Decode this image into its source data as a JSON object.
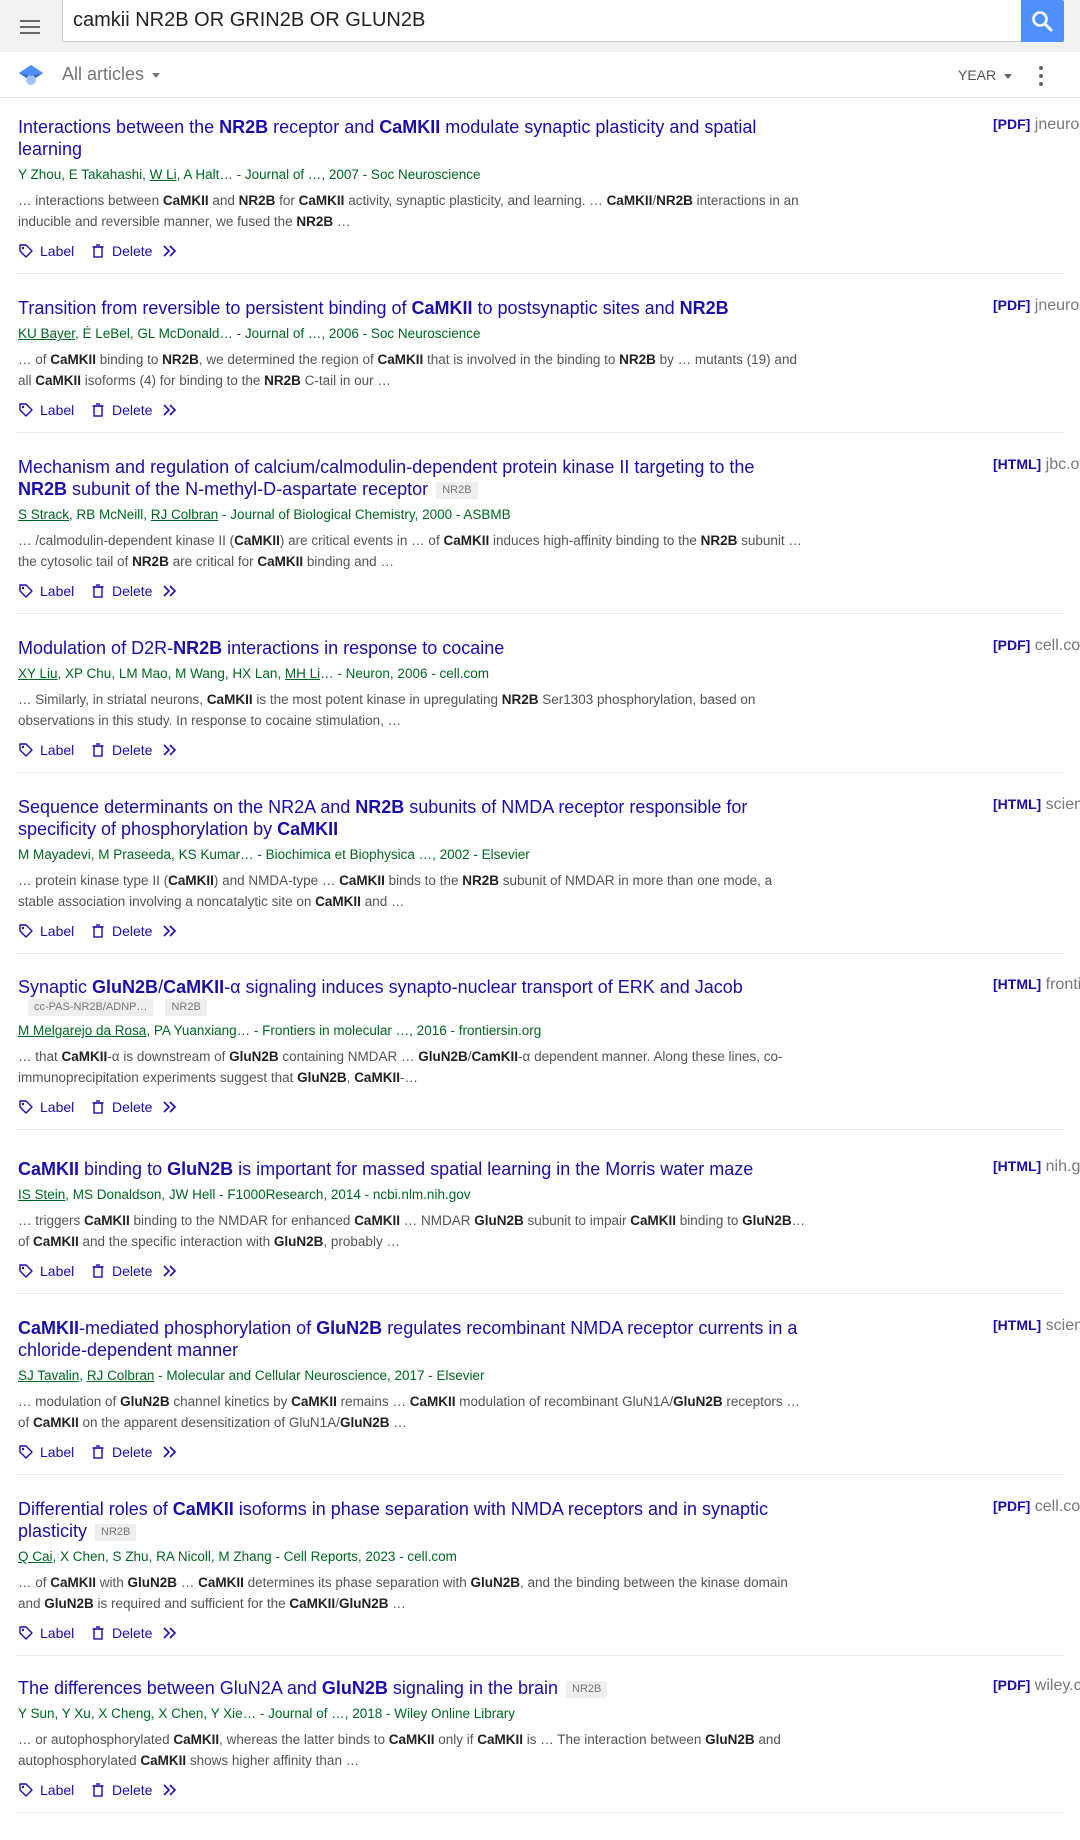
{
  "search": {
    "query": "camkii NR2B OR GRIN2B OR GLUN2B"
  },
  "filter": {
    "all_articles": "All articles",
    "year": "YEAR"
  },
  "actions": {
    "label": "Label",
    "delete": "Delete"
  },
  "results": [
    {
      "title_html": "Interactions between the <b>NR2B</b> receptor and <b>CaMKII</b> modulate synaptic plasticity and spatial learning",
      "authors_html": "Y Zhou, E Takahashi, <u>W Li</u>, A Halt… - Journal of …, 2007 - Soc Neuroscience",
      "snippet_html": "… interactions between <b>CaMKII</b> and <b>NR2B</b> for <b>CaMKII</b> activity, synaptic plasticity, and learning. … <b>CaMKII</b>/<b>NR2B</b> interactions in an inducible and reversible manner, we fused the <b>NR2B</b> …",
      "file_tag": "[PDF]",
      "file_domain": "jneurosci.org"
    },
    {
      "title_html": "Transition from reversible to persistent binding of <b>CaMKII</b> to postsynaptic sites and <b>NR2B</b>",
      "authors_html": "<u>KU Bayer</u>, É LeBel, GL McDonald… - Journal of …, 2006 - Soc Neuroscience",
      "snippet_html": "… of <b>CaMKII</b> binding to <b>NR2B</b>, we determined the region of <b>CaMKII</b> that is involved in the binding to <b>NR2B</b> by … mutants (19) and all <b>CaMKII</b> isoforms (4) for binding to the <b>NR2B</b> C-tail in our …",
      "file_tag": "[PDF]",
      "file_domain": "jneurosci.org"
    },
    {
      "title_html": "Mechanism and regulation of calcium/calmodulin-dependent protein kinase II targeting to the <b>NR2B</b> subunit of the N-methyl-D-aspartate receptor",
      "badges": [
        "NR2B"
      ],
      "authors_html": "<u>S Strack</u>, RB McNeill, <u>RJ Colbran</u> - Journal of Biological Chemistry, 2000 - ASBMB",
      "snippet_html": "… /calmodulin-dependent kinase II (<b>CaMKII</b>) are critical events in … of <b>CaMKII</b> induces high-affinity binding to the <b>NR2B</b> subunit … the cytosolic tail of <b>NR2B</b> are critical for <b>CaMKII</b> binding and …",
      "file_tag": "[HTML]",
      "file_domain": "jbc.org"
    },
    {
      "title_html": "Modulation of D2R-<b>NR2B</b> interactions in response to cocaine",
      "authors_html": "<u>XY Liu</u>, XP Chu, LM Mao, M Wang, HX Lan, <u>MH Li</u>… - Neuron, 2006 - cell.com",
      "snippet_html": "… Similarly, in striatal neurons, <b>CaMKII</b> is the most potent kinase in upregulating <b>NR2B</b> Ser1303 phosphorylation, based on observations in this study. In response to cocaine stimulation, …",
      "file_tag": "[PDF]",
      "file_domain": "cell.com"
    },
    {
      "title_html": "Sequence determinants on the NR2A and <b>NR2B</b> subunits of NMDA receptor responsible for specificity of phosphorylation by <b>CaMKII</b>",
      "authors_html": "M Mayadevi, M Praseeda, KS Kumar… - Biochimica et Biophysica …, 2002 - Elsevier",
      "snippet_html": "… protein kinase type II (<b>CaMKII</b>) and NMDA-type … <b>CaMKII</b> binds to the <b>NR2B</b> subunit of NMDAR in more than one mode, a stable association involving a noncatalytic site on <b>CaMKII</b> and …",
      "file_tag": "[HTML]",
      "file_domain": "sciencedirect.com"
    },
    {
      "title_html": "Synaptic <b>GluN2B</b>/<b>CaMKII</b>-α signaling induces synapto-nuclear transport of ERK and Jacob",
      "badge_row": [
        "cc-PAS-NR2B/ADNP…",
        "NR2B"
      ],
      "authors_html": "<u>M Melgarejo da Rosa</u>, PA Yuanxiang… - Frontiers in molecular …, 2016 - frontiersin.org",
      "snippet_html": "… that <b>CaMKII</b>-α is downstream of <b>GluN2B</b> containing NMDAR … <b>GluN2B</b>/<b>CamKII</b>-α dependent manner. Along these lines, co-immunoprecipitation experiments suggest that <b>GluN2B</b>, <b>CaMKII</b>-…",
      "file_tag": "[HTML]",
      "file_domain": "frontiersin.org"
    },
    {
      "title_html": "<b>CaMKII</b> binding to <b>GluN2B</b> is important for massed spatial learning in the Morris water maze",
      "authors_html": "<u>IS Stein</u>, MS Donaldson, JW Hell - F1000Research, 2014 - ncbi.nlm.nih.gov",
      "snippet_html": "… triggers <b>CaMKII</b> binding to the NMDAR for enhanced <b>CaMKII</b> … NMDAR <b>GluN2B</b> subunit to impair <b>CaMKII</b> binding to <b>GluN2B</b>… of <b>CaMKII</b> and the specific interaction with <b>GluN2B</b>, probably …",
      "file_tag": "[HTML]",
      "file_domain": "nih.gov"
    },
    {
      "title_html": "<b>CaMKII</b>-mediated phosphorylation of <b>GluN2B</b> regulates recombinant NMDA receptor currents in a chloride-dependent manner",
      "authors_html": "<u>SJ Tavalin</u>, <u>RJ Colbran</u> - Molecular and Cellular Neuroscience, 2017 - Elsevier",
      "snippet_html": "… modulation of <b>GluN2B</b> channel kinetics by <b>CaMKII</b> remains … <b>CaMKII</b> modulation of recombinant GluN1A/<b>GluN2B</b> receptors … of <b>CaMKII</b> on the apparent desensitization of GluN1A/<b>GluN2B</b> …",
      "file_tag": "[HTML]",
      "file_domain": "sciencedirect.com"
    },
    {
      "title_html": "Differential roles of <b>CaMKII</b> isoforms in phase separation with NMDA receptors and in synaptic plasticity",
      "badges": [
        "NR2B"
      ],
      "authors_html": "<u>Q Cai</u>, X Chen, S Zhu, RA Nicoll, M Zhang - Cell Reports, 2023 - cell.com",
      "snippet_html": "… of <b>CaMKII</b> with <b>GluN2B</b> … <b>CaMKII</b> determines its phase separation with <b>GluN2B</b>, and the binding between the kinase domain and <b>GluN2B</b> is required and sufficient for the <b>CaMKII</b>/<b>GluN2B</b> …",
      "file_tag": "[PDF]",
      "file_domain": "cell.com"
    },
    {
      "title_html": "The differences between GluN2A and <b>GluN2B</b> signaling in the brain",
      "badges": [
        "NR2B"
      ],
      "authors_html": "Y Sun, Y Xu, X Cheng, X Chen, Y Xie… - Journal of …, 2018 - Wiley Online Library",
      "snippet_html": "… or autophosphorylated <b>CaMKII</b>, whereas the latter binds to <b>CaMKII</b> only if <b>CaMKII</b> is … The interaction between <b>GluN2B</b> and autophosphorylated <b>CaMKII</b> shows higher affinity than …",
      "file_tag": "[PDF]",
      "file_domain": "wiley.com"
    }
  ]
}
